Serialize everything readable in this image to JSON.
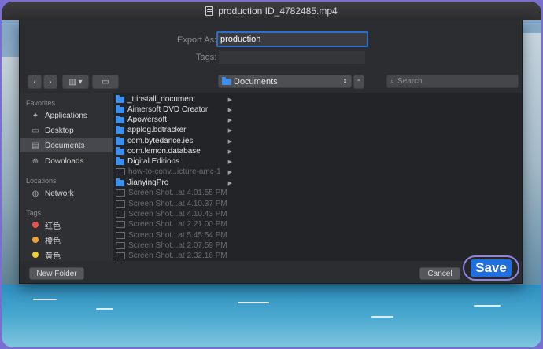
{
  "window": {
    "title": "production ID_4782485.mp4"
  },
  "form": {
    "export_label": "Export As:",
    "export_value": "production",
    "tags_label": "Tags:"
  },
  "toolbar": {
    "location": "Documents",
    "search_placeholder": "Search"
  },
  "sidebar": {
    "favorites_header": "Favorites",
    "favorites": [
      {
        "label": "Applications",
        "icon": "applications-icon"
      },
      {
        "label": "Desktop",
        "icon": "desktop-icon"
      },
      {
        "label": "Documents",
        "icon": "documents-icon",
        "selected": true
      },
      {
        "label": "Downloads",
        "icon": "downloads-icon"
      }
    ],
    "locations_header": "Locations",
    "locations": [
      {
        "label": "Network",
        "icon": "network-icon"
      }
    ],
    "tags_header": "Tags",
    "tags": [
      {
        "label": "红色",
        "color": "#e5544b"
      },
      {
        "label": "橙色",
        "color": "#f0a23a"
      },
      {
        "label": "黄色",
        "color": "#f0cf2e"
      }
    ]
  },
  "files": [
    {
      "name": "_ttinstall_document",
      "type": "folder"
    },
    {
      "name": "Aimersoft DVD Creator",
      "type": "folder"
    },
    {
      "name": "Apowersoft",
      "type": "folder"
    },
    {
      "name": "applog.bdtracker",
      "type": "folder"
    },
    {
      "name": "com.bytedance.ies",
      "type": "folder"
    },
    {
      "name": "com.lemon.database",
      "type": "folder"
    },
    {
      "name": "Digital Editions",
      "type": "folder"
    },
    {
      "name": "how-to-conv...icture-amc-1",
      "type": "file"
    },
    {
      "name": "JianyingPro",
      "type": "folder"
    },
    {
      "name": "Screen Shot...at 4.01.55 PM",
      "type": "file"
    },
    {
      "name": "Screen Shot...at 4.10.37 PM",
      "type": "file"
    },
    {
      "name": "Screen Shot...at 4.10.43 PM",
      "type": "file"
    },
    {
      "name": "Screen Shot...at 2.21.00 PM",
      "type": "file"
    },
    {
      "name": "Screen Shot...at 5.45.54 PM",
      "type": "file"
    },
    {
      "name": "Screen Shot...at 2.07.59 PM",
      "type": "file"
    },
    {
      "name": "Screen Shot...at 2.32.16 PM",
      "type": "file"
    }
  ],
  "buttons": {
    "new_folder": "New Folder",
    "cancel": "Cancel",
    "save": "Save"
  },
  "colors": {
    "accent": "#1f6fe0",
    "highlight_ring": "#8e84e8",
    "folder": "#3a8ff0"
  }
}
